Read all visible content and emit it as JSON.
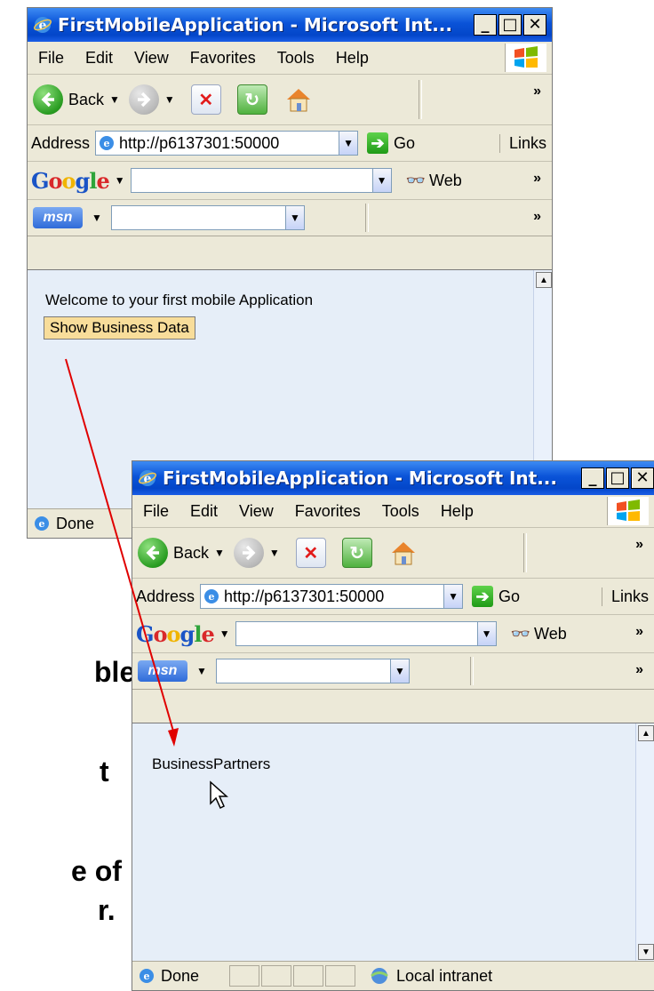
{
  "background_text": {
    "line1": "ble",
    "line2": "t",
    "line3": "e of",
    "line4": "r."
  },
  "window1": {
    "title": "FirstMobileApplication - Microsoft Int...",
    "menu": [
      "File",
      "Edit",
      "View",
      "Favorites",
      "Tools",
      "Help"
    ],
    "toolbar": {
      "back_label": "Back"
    },
    "address": {
      "label": "Address",
      "url": "http://p6137301:50000",
      "go_label": "Go",
      "links_label": "Links"
    },
    "google": {
      "logo": "Google",
      "web_label": "Web"
    },
    "msn": {
      "logo": "msn"
    },
    "page": {
      "welcome_text": "Welcome to your first mobile Application",
      "button_label": "Show Business Data"
    },
    "status": {
      "text": "Done"
    }
  },
  "window2": {
    "title": "FirstMobileApplication - Microsoft Int...",
    "menu": [
      "File",
      "Edit",
      "View",
      "Favorites",
      "Tools",
      "Help"
    ],
    "toolbar": {
      "back_label": "Back"
    },
    "address": {
      "label": "Address",
      "url": "http://p6137301:50000",
      "go_label": "Go",
      "links_label": "Links"
    },
    "google": {
      "logo": "Google",
      "web_label": "Web"
    },
    "msn": {
      "logo": "msn"
    },
    "page": {
      "heading_text": "BusinessPartners"
    },
    "status": {
      "text": "Done",
      "zone": "Local intranet"
    }
  },
  "colors": {
    "titlebar": "#0a53d8",
    "chrome": "#ece9d8",
    "content_bg": "#e6eef8",
    "button_bg": "#f8dd9a",
    "arrow": "#e00000"
  }
}
